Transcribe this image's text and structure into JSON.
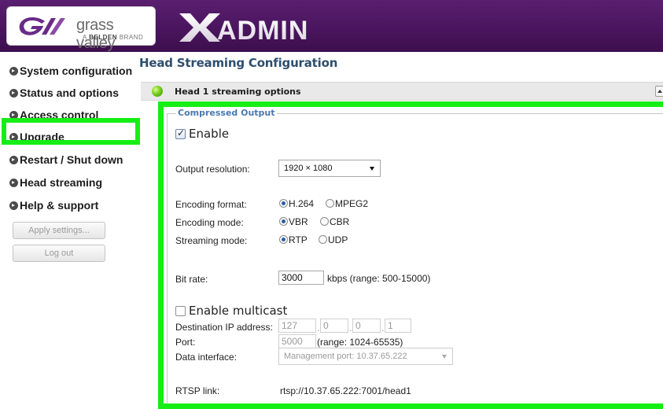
{
  "header": {
    "logo_text": "grass valley",
    "logo_sub_prefix": "A ",
    "logo_sub_brand": "BELDEN",
    "logo_sub_suffix": " BRAND",
    "app_name": "XADMIN",
    "logo_icon": "grass-valley-logo-icon",
    "colors": {
      "header_bg": "#4a155e",
      "accent_green": "#16ee16"
    }
  },
  "sidebar": {
    "items": [
      {
        "label": "System configuration",
        "icon": "bullet-arrow-icon"
      },
      {
        "label": "Status and options",
        "icon": "bullet-arrow-icon"
      },
      {
        "label": "Access control",
        "icon": "bullet-arrow-icon"
      },
      {
        "label": "Upgrade",
        "icon": "bullet-arrow-icon"
      },
      {
        "label": "Restart / Shut down",
        "icon": "bullet-arrow-icon"
      },
      {
        "label": "Head streaming",
        "icon": "bullet-arrow-icon",
        "selected": true
      },
      {
        "label": "Help & support",
        "icon": "bullet-arrow-icon"
      }
    ],
    "apply_button": "Apply settings...",
    "logout_button": "Log out"
  },
  "main": {
    "page_title": "Head Streaming Configuration",
    "section_title": "Head 1 streaming options",
    "section_status": "green-status-dot-icon",
    "fieldset_legend": "Compressed Output",
    "enable_label": "Enable",
    "enable_checked": true,
    "output_resolution": {
      "label": "Output resolution:",
      "value": "1920 × 1080"
    },
    "encoding_format": {
      "label": "Encoding format:",
      "options": [
        "H.264",
        "MPEG2"
      ],
      "selected": "H.264"
    },
    "encoding_mode": {
      "label": "Encoding mode:",
      "options": [
        "VBR",
        "CBR"
      ],
      "selected": "VBR"
    },
    "streaming_mode": {
      "label": "Streaming mode:",
      "options": [
        "RTP",
        "UDP"
      ],
      "selected": "RTP"
    },
    "bit_rate": {
      "label": "Bit rate:",
      "value": "3000",
      "unit": "kbps (range: 500-15000)"
    },
    "multicast": {
      "label": "Enable multicast",
      "checked": false
    },
    "destination_ip": {
      "label": "Destination IP address:",
      "octets": [
        "127",
        "0",
        "0",
        "1"
      ]
    },
    "port": {
      "label": "Port:",
      "value": "5000",
      "range": "(range: 1024-65535)"
    },
    "data_interface": {
      "label": "Data interface:",
      "value": "Management port: 10.37.65.222"
    },
    "rtsp_link": {
      "label": "RTSP link:",
      "value": "rtsp://10.37.65.222:7001/head1"
    }
  }
}
